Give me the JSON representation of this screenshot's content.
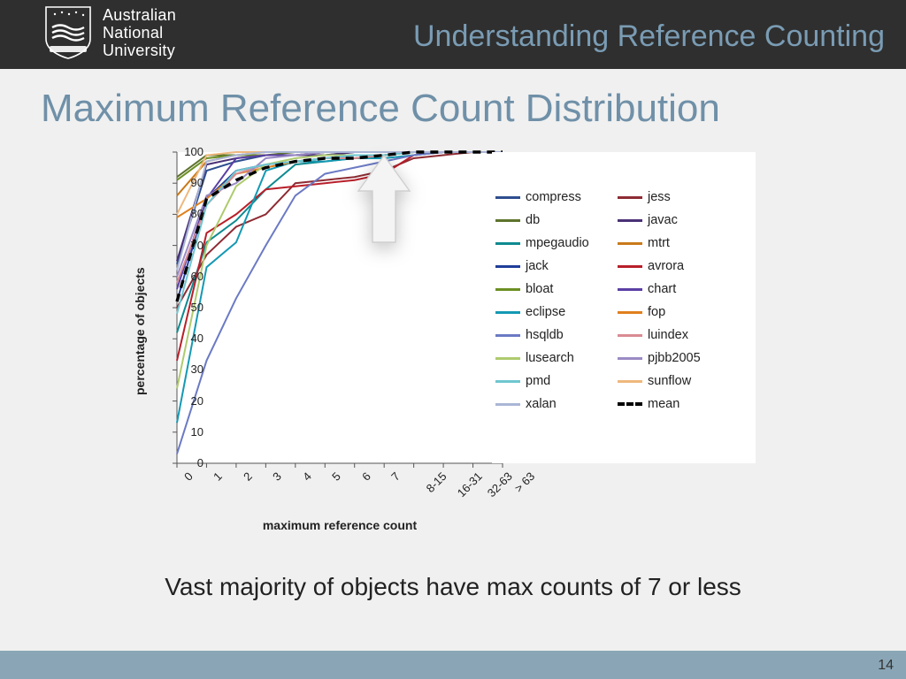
{
  "header": {
    "institution": "Australian\nNational\nUniversity",
    "title": "Understanding Reference Counting"
  },
  "title": "Maximum Reference Count Distribution",
  "caption": "Vast majority of objects have max counts of 7 or less",
  "page_number": "14",
  "chart_data": {
    "type": "line",
    "title": "",
    "xlabel": "maximum reference count",
    "ylabel": "percentage of objects",
    "ylim": [
      0,
      100
    ],
    "ytick": [
      0,
      10,
      20,
      30,
      40,
      50,
      60,
      70,
      80,
      90,
      100
    ],
    "categories": [
      "0",
      "1",
      "2",
      "3",
      "4",
      "5",
      "6",
      "7",
      "8-15",
      "16-31",
      "32-63",
      "> 63"
    ],
    "legend_position": "right",
    "series": [
      {
        "name": "compress",
        "color": "#2e4e8e",
        "values": [
          64,
          94,
          97,
          99,
          99,
          99,
          100,
          100,
          100,
          100,
          100,
          100
        ]
      },
      {
        "name": "jess",
        "color": "#8e2b33",
        "values": [
          50,
          67,
          76,
          80,
          90,
          91,
          92,
          94,
          98,
          99,
          100,
          100
        ]
      },
      {
        "name": "db",
        "color": "#5e732c",
        "values": [
          92,
          99,
          99,
          99,
          100,
          100,
          100,
          100,
          100,
          100,
          100,
          100
        ]
      },
      {
        "name": "javac",
        "color": "#4a3176",
        "values": [
          65,
          96,
          98,
          99,
          99,
          99,
          100,
          100,
          100,
          100,
          100,
          100
        ]
      },
      {
        "name": "mpegaudio",
        "color": "#0e8a90",
        "values": [
          42,
          71,
          78,
          88,
          96,
          97,
          98,
          99,
          100,
          100,
          100,
          100
        ]
      },
      {
        "name": "mtrt",
        "color": "#c97a1a",
        "values": [
          86,
          97,
          99,
          100,
          100,
          100,
          100,
          100,
          100,
          100,
          100,
          100
        ]
      },
      {
        "name": "jack",
        "color": "#1f3d99",
        "values": [
          52,
          85,
          94,
          96,
          97,
          98,
          99,
          99,
          100,
          100,
          100,
          100
        ]
      },
      {
        "name": "avrora",
        "color": "#b81f2a",
        "values": [
          33,
          74,
          80,
          88,
          89,
          90,
          91,
          93,
          99,
          100,
          100,
          100
        ]
      },
      {
        "name": "bloat",
        "color": "#6c8f23",
        "values": [
          91,
          98,
          99,
          99,
          99,
          100,
          100,
          100,
          100,
          100,
          100,
          100
        ]
      },
      {
        "name": "chart",
        "color": "#5b3fa4",
        "values": [
          56,
          85,
          98,
          99,
          99,
          100,
          100,
          100,
          100,
          100,
          100,
          100
        ]
      },
      {
        "name": "eclipse",
        "color": "#1599b3",
        "values": [
          13,
          63,
          71,
          94,
          97,
          97,
          98,
          98,
          99,
          100,
          100,
          100
        ]
      },
      {
        "name": "fop",
        "color": "#e0801d",
        "values": [
          79,
          85,
          93,
          95,
          97,
          98,
          98,
          99,
          100,
          100,
          100,
          100
        ]
      },
      {
        "name": "hsqldb",
        "color": "#6b7ac4",
        "values": [
          3,
          33,
          53,
          70,
          86,
          93,
          95,
          97,
          99,
          100,
          100,
          100
        ]
      },
      {
        "name": "luindex",
        "color": "#d98b92",
        "values": [
          58,
          83,
          93,
          96,
          97,
          98,
          98,
          99,
          100,
          100,
          100,
          100
        ]
      },
      {
        "name": "lusearch",
        "color": "#aecb6e",
        "values": [
          24,
          70,
          89,
          96,
          98,
          99,
          99,
          99,
          100,
          100,
          100,
          100
        ]
      },
      {
        "name": "pjbb2005",
        "color": "#9a8bc4",
        "values": [
          60,
          86,
          90,
          98,
          99,
          100,
          100,
          100,
          100,
          100,
          100,
          100
        ]
      },
      {
        "name": "pmd",
        "color": "#6fc6d0",
        "values": [
          48,
          83,
          94,
          96,
          97,
          98,
          99,
          99,
          100,
          100,
          100,
          100
        ]
      },
      {
        "name": "sunflow",
        "color": "#efb87e",
        "values": [
          80,
          99,
          100,
          100,
          100,
          100,
          100,
          100,
          100,
          100,
          100,
          100
        ]
      },
      {
        "name": "xalan",
        "color": "#aab6d6",
        "values": [
          62,
          97,
          99,
          100,
          100,
          100,
          100,
          100,
          100,
          100,
          100,
          100
        ]
      },
      {
        "name": "mean",
        "color": "#000000",
        "dashed": true,
        "values": [
          52,
          85,
          91,
          95,
          97,
          98,
          98,
          99,
          100,
          100,
          100,
          100
        ]
      }
    ],
    "legend_layout": [
      [
        "compress",
        "jess"
      ],
      [
        "db",
        "javac"
      ],
      [
        "mpegaudio",
        "mtrt"
      ],
      [
        "jack",
        "avrora"
      ],
      [
        "bloat",
        "chart"
      ],
      [
        "eclipse",
        "fop"
      ],
      [
        "hsqldb",
        "luindex"
      ],
      [
        "lusearch",
        "pjbb2005"
      ],
      [
        "pmd",
        "sunflow"
      ],
      [
        "xalan",
        "mean"
      ]
    ]
  }
}
